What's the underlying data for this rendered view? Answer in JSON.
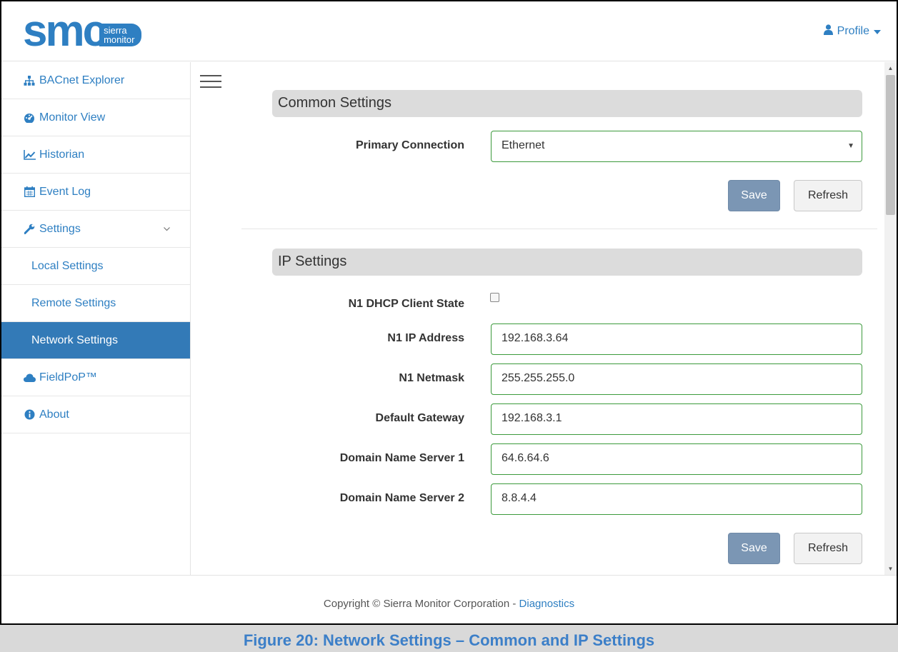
{
  "header": {
    "logo_text": "smc",
    "logo_sub_1": "sierra",
    "logo_sub_2": "monitor",
    "profile_label": "Profile",
    "profile_icon": "user-icon",
    "accent_color": "#2e7fc2"
  },
  "sidebar": {
    "items": [
      {
        "label": "BACnet Explorer",
        "icon": "sitemap-icon"
      },
      {
        "label": "Monitor View",
        "icon": "dashboard-icon"
      },
      {
        "label": "Historian",
        "icon": "line-chart-icon"
      },
      {
        "label": "Event Log",
        "icon": "calendar-icon"
      },
      {
        "label": "Settings",
        "icon": "wrench-icon",
        "expanded": true
      },
      {
        "label": "Local Settings"
      },
      {
        "label": "Remote Settings"
      },
      {
        "label": "Network Settings",
        "active": true
      },
      {
        "label": "FieldPoP™",
        "icon": "cloud-icon"
      },
      {
        "label": "About",
        "icon": "info-icon"
      }
    ],
    "active_color": "#337ab7"
  },
  "common": {
    "title": "Common Settings",
    "primary_connection_label": "Primary Connection",
    "primary_connection_value": "Ethernet",
    "save_label": "Save",
    "refresh_label": "Refresh"
  },
  "ip": {
    "title": "IP Settings",
    "dhcp_label": "N1 DHCP Client State",
    "dhcp_checked": false,
    "ip_label": "N1 IP Address",
    "ip_value": "192.168.3.64",
    "netmask_label": "N1 Netmask",
    "netmask_value": "255.255.255.0",
    "gateway_label": "Default Gateway",
    "gateway_value": "192.168.3.1",
    "dns1_label": "Domain Name Server 1",
    "dns1_value": "64.6.64.6",
    "dns2_label": "Domain Name Server 2",
    "dns2_value": "8.8.4.4",
    "save_label": "Save",
    "refresh_label": "Refresh"
  },
  "footer": {
    "copyright": "Copyright © Sierra Monitor Corporation - ",
    "diagnostics_link": "Diagnostics"
  },
  "caption": {
    "text": "Figure 20: Network Settings – Common and IP Settings"
  }
}
